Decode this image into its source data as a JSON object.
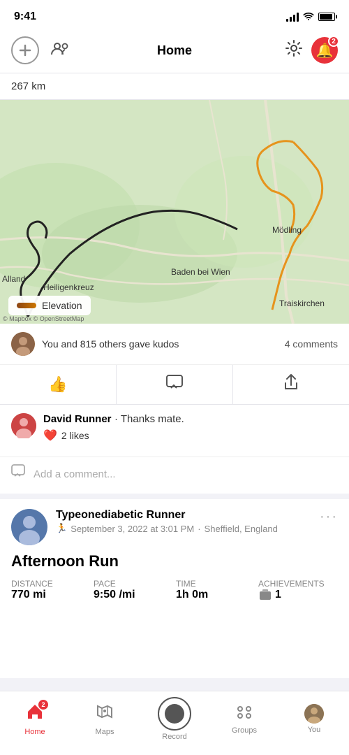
{
  "statusBar": {
    "time": "9:41",
    "batteryLevel": 90
  },
  "header": {
    "title": "Home",
    "addButtonLabel": "+",
    "notificationCount": "2"
  },
  "distanceBar": {
    "text": "267 km"
  },
  "map": {
    "elevationLabel": "Elevation",
    "mapCreditText": "© Mapbox © OpenStreetMap",
    "locationLabels": [
      "Mödling",
      "Heiligenkreuz",
      "Alland",
      "Baden bei Wien",
      "Traiskirchen"
    ]
  },
  "kudosSection": {
    "kudosText": "You and 815 others gave kudos",
    "commentsText": "4 comments"
  },
  "actionBar": {
    "kudosLabel": "Kudos",
    "commentLabel": "Comment",
    "shareLabel": "Share"
  },
  "comment": {
    "author": "David Runner",
    "separator": "·",
    "text": "Thanks mate.",
    "likesCount": "2 likes"
  },
  "addComment": {
    "placeholder": "Add a comment..."
  },
  "secondPost": {
    "username": "Typeonediabetic Runner",
    "datetime": "September 3, 2022 at 3:01 PM",
    "separator": "·",
    "location": "Sheffield, England",
    "title": "Afternoon Run",
    "stats": [
      {
        "label": "Distance",
        "value": "770 mi"
      },
      {
        "label": "Pace",
        "value": "9:50 /mi"
      },
      {
        "label": "Time",
        "value": "1h 0m"
      },
      {
        "label": "Achievements",
        "value": "1"
      }
    ]
  },
  "bottomNav": {
    "items": [
      {
        "id": "home",
        "label": "Home",
        "badge": "2",
        "active": true
      },
      {
        "id": "maps",
        "label": "Maps",
        "active": false
      },
      {
        "id": "record",
        "label": "Record",
        "active": false
      },
      {
        "id": "groups",
        "label": "Groups",
        "active": false
      },
      {
        "id": "you",
        "label": "You",
        "active": false
      }
    ]
  }
}
